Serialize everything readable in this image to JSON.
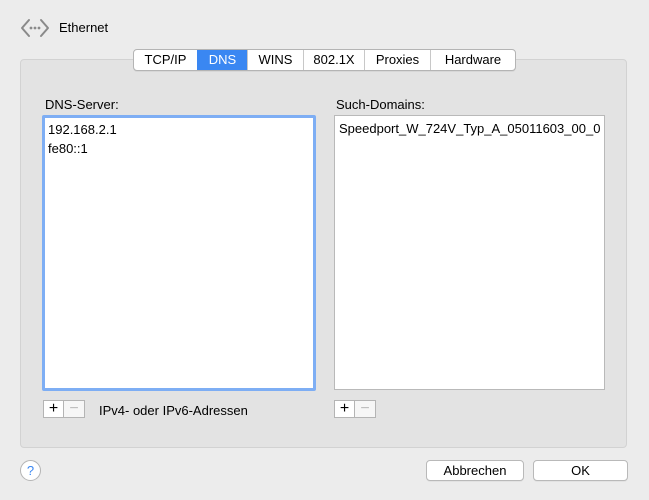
{
  "header": {
    "title": "Ethernet",
    "icon": "network-arrows-icon"
  },
  "tabs": [
    {
      "label": "TCP/IP",
      "active": false
    },
    {
      "label": "DNS",
      "active": true
    },
    {
      "label": "WINS",
      "active": false
    },
    {
      "label": "802.1X",
      "active": false
    },
    {
      "label": "Proxies",
      "active": false
    },
    {
      "label": "Hardware",
      "active": false
    }
  ],
  "dns": {
    "label": "DNS-Server:",
    "servers": [
      "192.168.2.1",
      "fe80::1"
    ],
    "hint": "IPv4- oder IPv6-Adressen",
    "add": "+",
    "remove": "−"
  },
  "domains": {
    "label": "Such-Domains:",
    "entries": [
      "Speedport_W_724V_Typ_A_05011603_00_0"
    ],
    "add": "+",
    "remove": "−"
  },
  "buttons": {
    "help": "?",
    "cancel": "Abbrechen",
    "ok": "OK"
  },
  "colors": {
    "accent": "#3a87f2",
    "focus_ring": "#7eaef4"
  }
}
